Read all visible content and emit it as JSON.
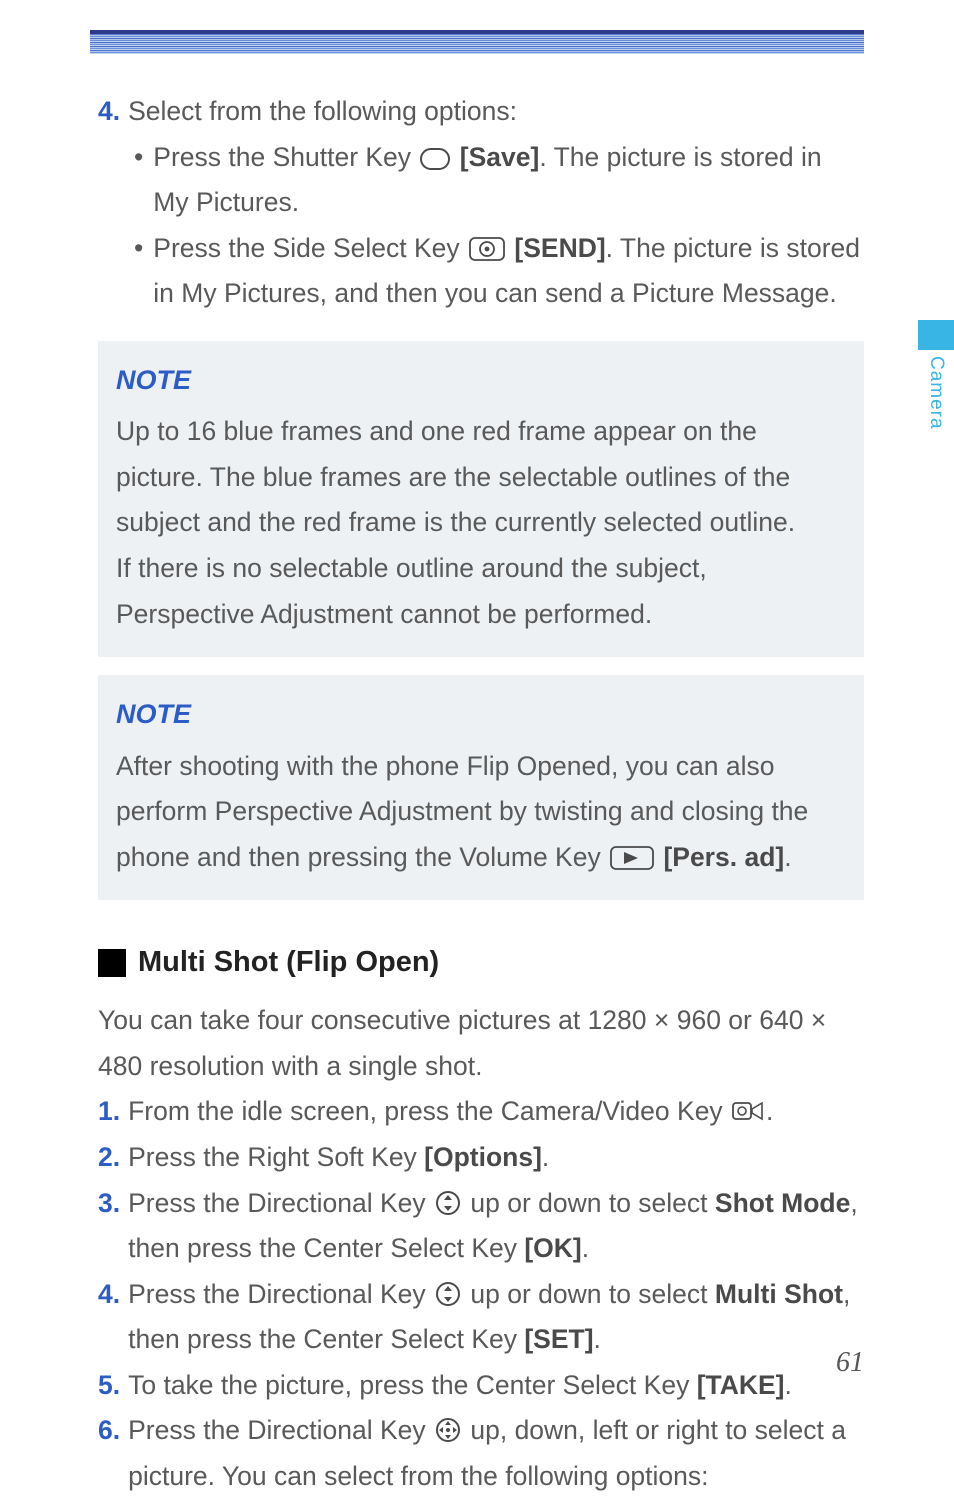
{
  "sideTab": {
    "label": "Camera"
  },
  "step4": {
    "num": "4.",
    "lead": "Select from the following options:",
    "bullet1a": "Press the Shutter Key ",
    "bullet1b": " [Save]",
    "bullet1c": ". The picture is stored in My Pictures.",
    "bullet2a": "Press the Side Select Key ",
    "bullet2b": " [SEND]",
    "bullet2c": ". The picture is stored in My Pictures, and then you can send a Picture Message."
  },
  "note1": {
    "title": "NOTE",
    "p1": "Up to 16 blue frames and one red frame appear on the picture. The blue frames are the selectable outlines of the subject and the red frame is the currently selected outline.",
    "p2": "If there is no selectable outline around the subject, Perspective Adjustment cannot be performed."
  },
  "note2": {
    "title": "NOTE",
    "p1a": "After shooting with the phone Flip Opened, you can also perform Perspective Adjustment by twisting and closing the phone and then pressing the Volume Key ",
    "p1b": " [Pers. ad]",
    "p1c": "."
  },
  "section": {
    "title": "Multi Shot (Flip Open)"
  },
  "intro": "You can take four consecutive pictures at 1280 × 960 or 640 × 480 resolution with a single shot.",
  "s1": {
    "num": "1.",
    "a": "From the idle screen, press the Camera/Video Key ",
    "b": "."
  },
  "s2": {
    "num": "2.",
    "a": "Press the Right Soft Key ",
    "b": "[Options]",
    "c": "."
  },
  "s3": {
    "num": "3.",
    "a": "Press the Directional Key ",
    "b": " up or down to select ",
    "c": "Shot Mode",
    "d": ", then press the Center Select Key ",
    "e": "[OK]",
    "f": "."
  },
  "s4": {
    "num": "4.",
    "a": "Press the Directional Key ",
    "b": " up or down to select ",
    "c": "Multi Shot",
    "d": ", then press the Center Select Key ",
    "e": "[SET]",
    "f": "."
  },
  "s5": {
    "num": "5.",
    "a": "To take the picture, press the Center Select Key ",
    "b": "[TAKE]",
    "c": "."
  },
  "s6": {
    "num": "6.",
    "a": "Press the Directional Key ",
    "b": " up, down, left or right to select a picture. You can select from the following options:"
  },
  "pageNum": "61"
}
